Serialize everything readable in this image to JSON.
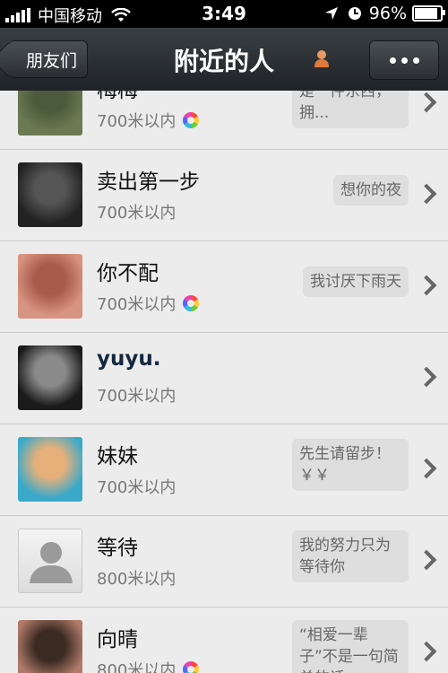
{
  "status_bar": {
    "carrier": "中国移动",
    "time": "3:49",
    "battery": "96%",
    "battery_level": 0.96
  },
  "nav": {
    "back_label": "朋友们",
    "title": "附近的人"
  },
  "rows": [
    {
      "name": "梅梅",
      "distance": "700米以内",
      "status": "小时候，幸福是一件东西，拥...",
      "has_album": true,
      "avatar": "photo"
    },
    {
      "name": "卖出第一步",
      "distance": "700米以内",
      "status": "想你的夜",
      "has_album": false,
      "avatar": "photo"
    },
    {
      "name": "你不配",
      "distance": "700米以内",
      "status": "我讨厌下雨天",
      "has_album": true,
      "avatar": "photo"
    },
    {
      "name": "yuyu.",
      "distance": "700米以内",
      "status": "",
      "has_album": false,
      "avatar": "photo"
    },
    {
      "name": "妹妹",
      "distance": "700米以内",
      "status": "先生请留步！￥￥",
      "has_album": false,
      "avatar": "photo"
    },
    {
      "name": "等待",
      "distance": "800米以内",
      "status": "我的努力只为等待你",
      "has_album": false,
      "avatar": "default"
    },
    {
      "name": "向晴",
      "distance": "800米以内",
      "status": "“相爱一辈子”不是一句简单的话,...",
      "has_album": true,
      "avatar": "photo"
    }
  ]
}
